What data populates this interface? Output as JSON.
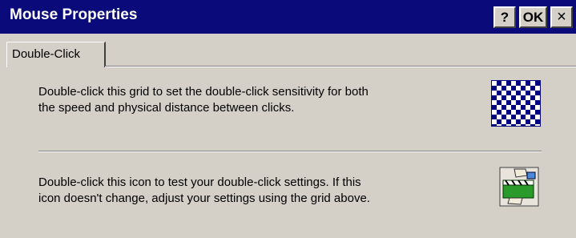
{
  "window": {
    "title": "Mouse Properties",
    "help_label": "?",
    "ok_label": "OK",
    "close_label": "×"
  },
  "tabs": [
    {
      "label": "Double-Click",
      "selected": true
    }
  ],
  "sections": {
    "grid_text": "Double-click this grid to set the double-click sensitivity for both\nthe speed and physical distance between clicks.",
    "test_text": "Double-click this icon to test your double-click settings. If this\nicon doesn't change, adjust your settings using the grid above."
  },
  "icons": {
    "grid": "checkerboard-grid-icon",
    "test": "clapperboard-test-icon"
  },
  "colors": {
    "titlebar": "#0a0a7a",
    "grid": "#000080",
    "face": "#d4d0c8"
  }
}
